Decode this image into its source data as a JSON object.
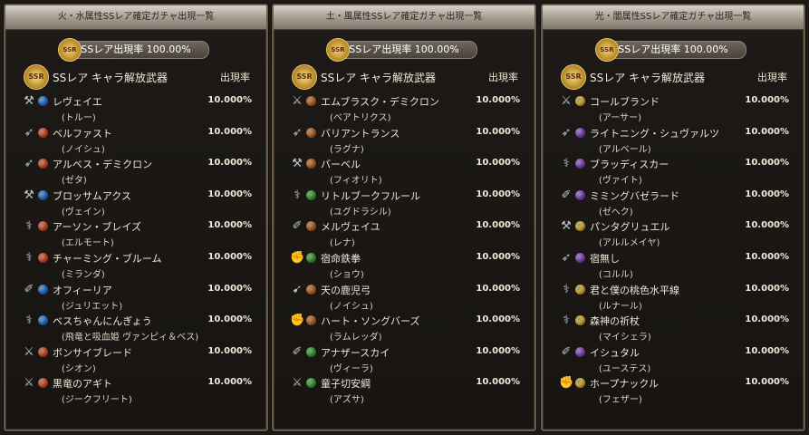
{
  "colors": {
    "fire": "#e2582b",
    "water": "#2f7fe0",
    "earth": "#c8702a",
    "wind": "#3fae3a",
    "light": "#e9c23a",
    "dark": "#8e4fd8"
  },
  "panels": [
    {
      "title": "火・水属性SSレア確定ガチャ出現一覧",
      "rate_label": "SSレア出現率 100.00%",
      "header_label": "SSレア キャラ解放武器",
      "header_rate": "出現率",
      "items": [
        {
          "weapon": "レヴェイエ",
          "char": "(トルー)",
          "rate": "10.000%",
          "element": "water",
          "icon": "axe-icon"
        },
        {
          "weapon": "ベルファスト",
          "char": "(ノイシュ)",
          "rate": "10.000%",
          "element": "fire",
          "icon": "spear-icon"
        },
        {
          "weapon": "アルベス・デミクロン",
          "char": "(ゼタ)",
          "rate": "10.000%",
          "element": "fire",
          "icon": "spear-icon"
        },
        {
          "weapon": "ブロッサムアクス",
          "char": "(ヴェイン)",
          "rate": "10.000%",
          "element": "water",
          "icon": "axe-icon"
        },
        {
          "weapon": "アーソン・ブレイズ",
          "char": "(エルモート)",
          "rate": "10.000%",
          "element": "fire",
          "icon": "staff-icon"
        },
        {
          "weapon": "チャーミング・ブルーム",
          "char": "(ミランダ)",
          "rate": "10.000%",
          "element": "fire",
          "icon": "staff-icon"
        },
        {
          "weapon": "オフィーリア",
          "char": "(ジュリエット)",
          "rate": "10.000%",
          "element": "water",
          "icon": "gun-icon"
        },
        {
          "weapon": "ベスちゃんにんぎょう",
          "char": "(飛竜と吸血姫 ヴァンピィ＆ベス)",
          "rate": "10.000%",
          "element": "water",
          "icon": "staff-icon"
        },
        {
          "weapon": "ボンサイブレード",
          "char": "(シオン)",
          "rate": "10.000%",
          "element": "fire",
          "icon": "sword-icon"
        },
        {
          "weapon": "黒竜のアギト",
          "char": "(ジークフリート)",
          "rate": "10.000%",
          "element": "fire",
          "icon": "sword-icon"
        }
      ]
    },
    {
      "title": "土・風属性SSレア確定ガチャ出現一覧",
      "rate_label": "SSレア出現率 100.00%",
      "header_label": "SSレア キャラ解放武器",
      "header_rate": "出現率",
      "items": [
        {
          "weapon": "エムブラスク・デミクロン",
          "char": "(ベアトリクス)",
          "rate": "10.000%",
          "element": "earth",
          "icon": "sword-icon"
        },
        {
          "weapon": "バリアントランス",
          "char": "(ラグナ)",
          "rate": "10.000%",
          "element": "earth",
          "icon": "spear-icon"
        },
        {
          "weapon": "バーベル",
          "char": "(フィオリト)",
          "rate": "10.000%",
          "element": "earth",
          "icon": "axe-icon"
        },
        {
          "weapon": "リトルブークフルール",
          "char": "(ユグドラシル)",
          "rate": "10.000%",
          "element": "wind",
          "icon": "staff-icon"
        },
        {
          "weapon": "メルヴェイユ",
          "char": "(レナ)",
          "rate": "10.000%",
          "element": "earth",
          "icon": "gun-icon"
        },
        {
          "weapon": "宿命鉄拳",
          "char": "(ショウ)",
          "rate": "10.000%",
          "element": "wind",
          "icon": "fist-icon"
        },
        {
          "weapon": "天の鹿児弓",
          "char": "(ノイシュ)",
          "rate": "10.000%",
          "element": "earth",
          "icon": "bow-icon"
        },
        {
          "weapon": "ハート・ソングバーズ",
          "char": "(ラムレッダ)",
          "rate": "10.000%",
          "element": "earth",
          "icon": "fist-icon"
        },
        {
          "weapon": "アナザースカイ",
          "char": "(ヴィーラ)",
          "rate": "10.000%",
          "element": "wind",
          "icon": "gun-icon"
        },
        {
          "weapon": "童子切安綱",
          "char": "(アズサ)",
          "rate": "10.000%",
          "element": "wind",
          "icon": "sword-icon"
        }
      ]
    },
    {
      "title": "光・闇属性SSレア確定ガチャ出現一覧",
      "rate_label": "SSレア出現率 100.00%",
      "header_label": "SSレア キャラ解放武器",
      "header_rate": "出現率",
      "items": [
        {
          "weapon": "コールブランド",
          "char": "(アーサー)",
          "rate": "10.000%",
          "element": "light",
          "icon": "sword-icon"
        },
        {
          "weapon": "ライトニング・シュヴァルツ",
          "char": "(アルベール)",
          "rate": "10.000%",
          "element": "dark",
          "icon": "spear-icon"
        },
        {
          "weapon": "ブラッディスカー",
          "char": "(ヴァイト)",
          "rate": "10.000%",
          "element": "dark",
          "icon": "staff-icon"
        },
        {
          "weapon": "ミミングバゼラード",
          "char": "(ゼヘク)",
          "rate": "10.000%",
          "element": "dark",
          "icon": "gun-icon"
        },
        {
          "weapon": "パンタグリュエル",
          "char": "(アルルメイヤ)",
          "rate": "10.000%",
          "element": "light",
          "icon": "axe-icon"
        },
        {
          "weapon": "宿無し",
          "char": "(コルル)",
          "rate": "10.000%",
          "element": "dark",
          "icon": "spear-icon"
        },
        {
          "weapon": "君と僕の桃色水平線",
          "char": "(ルナール)",
          "rate": "10.000%",
          "element": "light",
          "icon": "staff-icon"
        },
        {
          "weapon": "森神の祈杖",
          "char": "(マイシェラ)",
          "rate": "10.000%",
          "element": "light",
          "icon": "staff-icon"
        },
        {
          "weapon": "イシュタル",
          "char": "(ユーステス)",
          "rate": "10.000%",
          "element": "dark",
          "icon": "gun-icon"
        },
        {
          "weapon": "ホープナックル",
          "char": "(フェザー)",
          "rate": "10.000%",
          "element": "light",
          "icon": "fist-icon"
        }
      ]
    }
  ]
}
